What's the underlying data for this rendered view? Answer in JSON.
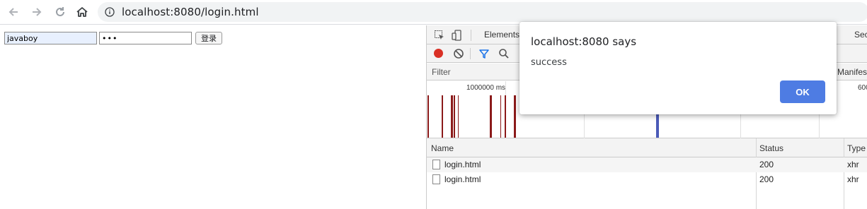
{
  "browser": {
    "url": "localhost:8080/login.html",
    "icons": [
      "back-arrow-icon",
      "forward-arrow-icon",
      "reload-icon",
      "home-icon",
      "info-icon"
    ]
  },
  "page": {
    "username_value": "javaboy",
    "password_value": "•••",
    "login_label": "登录"
  },
  "devtools": {
    "tabs": [
      "Elements",
      "Sec"
    ],
    "filter_placeholder": "Filter",
    "manifest_label": "Manifes",
    "overview": {
      "tick_1": "1000000 ms",
      "tick_2": "600"
    },
    "table": {
      "columns": [
        "Name",
        "Status",
        "Type"
      ],
      "rows": [
        {
          "name": "login.html",
          "status": "200",
          "type": "xhr"
        },
        {
          "name": "login.html",
          "status": "200",
          "type": "xhr"
        }
      ]
    },
    "colors": {
      "record": "#d93025",
      "bar": "#8b1a1a",
      "bar_blue": "#4b5bb8"
    }
  },
  "dialog": {
    "title": "localhost:8080 says",
    "message": "success",
    "ok_label": "OK",
    "ok_color": "#4e7ce3"
  }
}
